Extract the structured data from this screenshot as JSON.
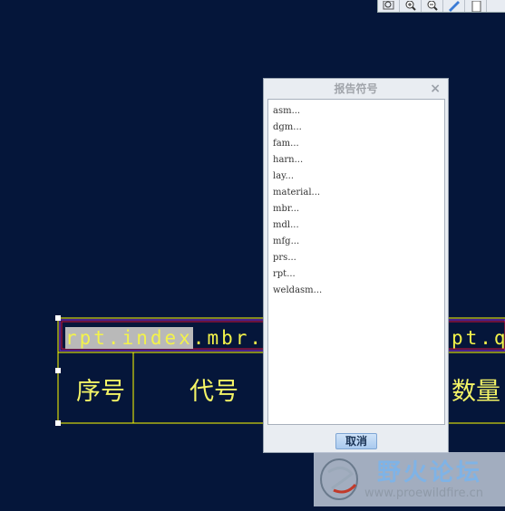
{
  "toolbar": {
    "buttons": [
      {
        "icon": "zoom-window-icon"
      },
      {
        "icon": "zoom-in-icon"
      },
      {
        "icon": "zoom-out-icon"
      },
      {
        "icon": "repaint-icon"
      },
      {
        "icon": "page-icon"
      }
    ]
  },
  "table": {
    "report_symbol_left": "rpt.index",
    "report_symbol_selected": "rpt.index",
    "report_symbol_rest": ".mbr.na",
    "report_symbol_right": "pt.q",
    "headers": [
      "序号",
      "代号",
      "数量"
    ],
    "line_color": "#ffff00",
    "highlight_border": "#c2185b"
  },
  "dialog": {
    "title": "报告符号",
    "close": "×",
    "items": [
      "asm...",
      "dgm...",
      "fam...",
      "harn...",
      "lay...",
      "material...",
      "mbr...",
      "mdl...",
      "mfg...",
      "prs...",
      "rpt...",
      "weldasm..."
    ],
    "cancel_label": "取消"
  },
  "watermark": {
    "title": "野火论坛",
    "url": "www.proewildfire.cn"
  }
}
